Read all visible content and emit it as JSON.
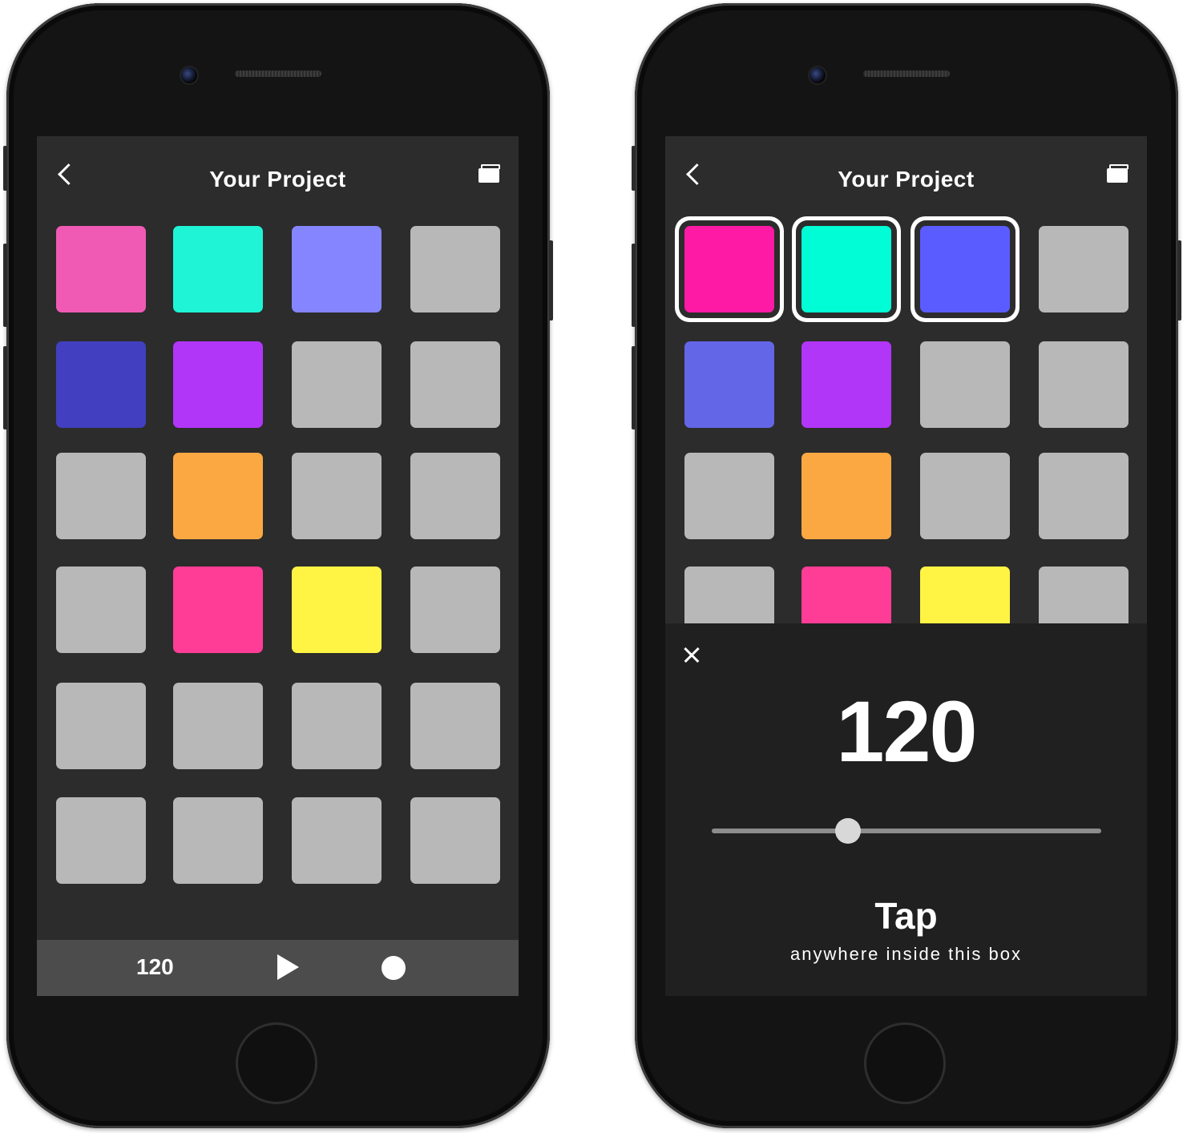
{
  "colors": {
    "gray": "#b8b8b8",
    "pink": "#f05ab4",
    "aqua": "#1ff5d6",
    "periwinkle": "#8585ff",
    "indigo": "#4240c0",
    "purple": "#b236f8",
    "orange": "#fca842",
    "hot_pink": "#ff3d96",
    "yellow": "#fff444",
    "magenta": "#ff1aa6",
    "cyan": "#00fdd5",
    "blue": "#5a5cff",
    "slate_blue": "#6466e8"
  },
  "left_phone": {
    "nav": {
      "title": "Your Project",
      "back_icon": "chevron-left-icon",
      "menu_icon": "folder-icon"
    },
    "pads": [
      [
        "pink",
        "aqua",
        "periwinkle",
        "gray"
      ],
      [
        "indigo",
        "purple",
        "gray",
        "gray"
      ],
      [
        "gray",
        "orange",
        "gray",
        "gray"
      ],
      [
        "gray",
        "hot_pink",
        "yellow",
        "gray"
      ],
      [
        "gray",
        "gray",
        "gray",
        "gray"
      ],
      [
        "gray",
        "gray",
        "gray",
        "gray"
      ]
    ],
    "transport": {
      "tempo": "120",
      "play_icon": "play-icon",
      "record_icon": "record-icon"
    }
  },
  "right_phone": {
    "nav": {
      "title": "Your Project",
      "back_icon": "chevron-left-icon",
      "menu_icon": "folder-icon"
    },
    "pads": [
      [
        "magenta",
        "cyan",
        "blue",
        "gray"
      ],
      [
        "slate_blue",
        "purple",
        "gray",
        "gray"
      ],
      [
        "gray",
        "orange",
        "gray",
        "gray"
      ],
      [
        "gray",
        "hot_pink",
        "yellow",
        "gray"
      ]
    ],
    "selected_pads": [
      [
        0,
        0
      ],
      [
        0,
        1
      ],
      [
        0,
        2
      ]
    ],
    "tempo_panel": {
      "close_icon": "close-icon",
      "bpm": "120",
      "slider_value": 0.35,
      "tap_title": "Tap",
      "tap_subtitle": "anywhere inside this box"
    }
  }
}
